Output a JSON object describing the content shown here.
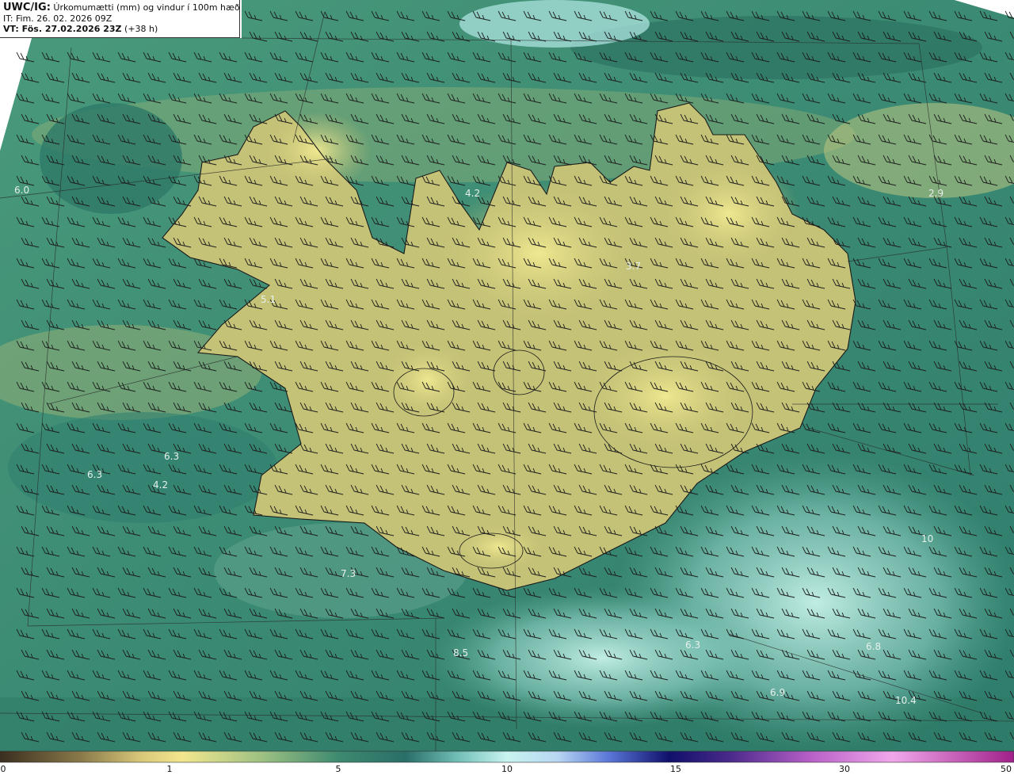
{
  "header": {
    "title_bold": "UWC/IG:",
    "title_rest": "Úrkomumætti (mm) og vindur í 100m hæð",
    "init_time": "IT: Fim. 26. 02. 2026 09Z",
    "valid_prefix": "VT: Fös. 27.02.2026 23Z",
    "valid_suffix": "(+38 h)"
  },
  "colorbar": {
    "ticks": [
      "0",
      "1",
      "5",
      "10",
      "15",
      "30",
      "50"
    ],
    "colors": [
      "#3a2e1f",
      "#8a7a4a",
      "#d8c97a",
      "#f2e68e",
      "#7fae7a",
      "#3e8a70",
      "#2a6e68",
      "#6fbdb6",
      "#b8ecec",
      "#c8dcf4",
      "#5a6ed8",
      "#1a1aa0",
      "#10106a",
      "#6a3a9a",
      "#d870d8",
      "#f0a0e8",
      "#a0208a"
    ]
  },
  "map": {
    "colors": {
      "sea_dark": "#27705f",
      "sea_mid": "#3b8a73",
      "land": "#c9c577",
      "land_high": "#ece68c",
      "bright_sea": "#b6e8dd",
      "coast": "#1a1a1a"
    },
    "value_labels": [
      {
        "text": "6.0"
      },
      {
        "text": "4.2"
      },
      {
        "text": "2.9"
      },
      {
        "text": "3.7"
      },
      {
        "text": "5.1"
      },
      {
        "text": "6.3"
      },
      {
        "text": "6.3"
      },
      {
        "text": "4.2"
      },
      {
        "text": "7.3"
      },
      {
        "text": "8.5"
      },
      {
        "text": "6.3"
      },
      {
        "text": "6.9"
      },
      {
        "text": "6.8"
      },
      {
        "text": "10.4"
      },
      {
        "text": "10"
      }
    ]
  }
}
